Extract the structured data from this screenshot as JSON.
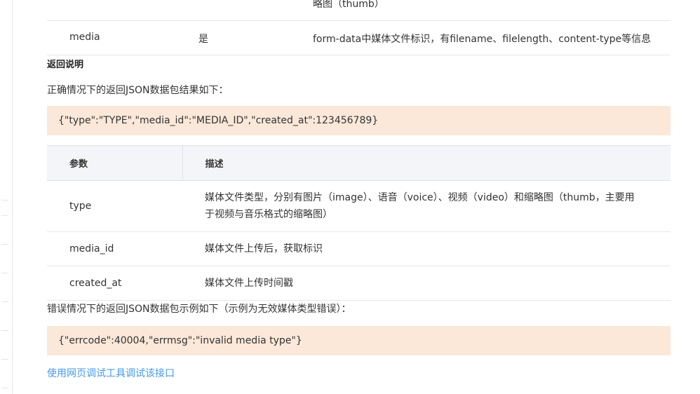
{
  "top_row": {
    "description_tail": "略图（thumb）"
  },
  "param_row": {
    "name": "media",
    "required": "是",
    "description": "form-data中媒体文件标识，有filename、filelength、content-type等信息"
  },
  "section_title": "返回说明",
  "success_intro": "正确情况下的返回JSON数据包结果如下：",
  "success_code": "{\"type\":\"TYPE\",\"media_id\":\"MEDIA_ID\",\"created_at\":123456789}",
  "return_table": {
    "headers": [
      "参数",
      "描述"
    ],
    "rows": [
      {
        "param": "type",
        "desc": "媒体文件类型，分别有图片（image）、语音（voice）、视频（video）和缩略图（thumb，主要用于视频与音乐格式的缩略图）"
      },
      {
        "param": "media_id",
        "desc": "媒体文件上传后，获取标识"
      },
      {
        "param": "created_at",
        "desc": "媒体文件上传时间戳"
      }
    ]
  },
  "error_intro": "错误情况下的返回JSON数据包示例如下（示例为无效媒体类型错误）：",
  "error_code": "{\"errcode\":40004,\"errmsg\":\"invalid media type\"}",
  "debug_link": "使用网页调试工具调试该接口",
  "colors": {
    "code_bg": "#fbe8d9",
    "header_bg": "#f4f5f9",
    "link": "#459ae9"
  }
}
